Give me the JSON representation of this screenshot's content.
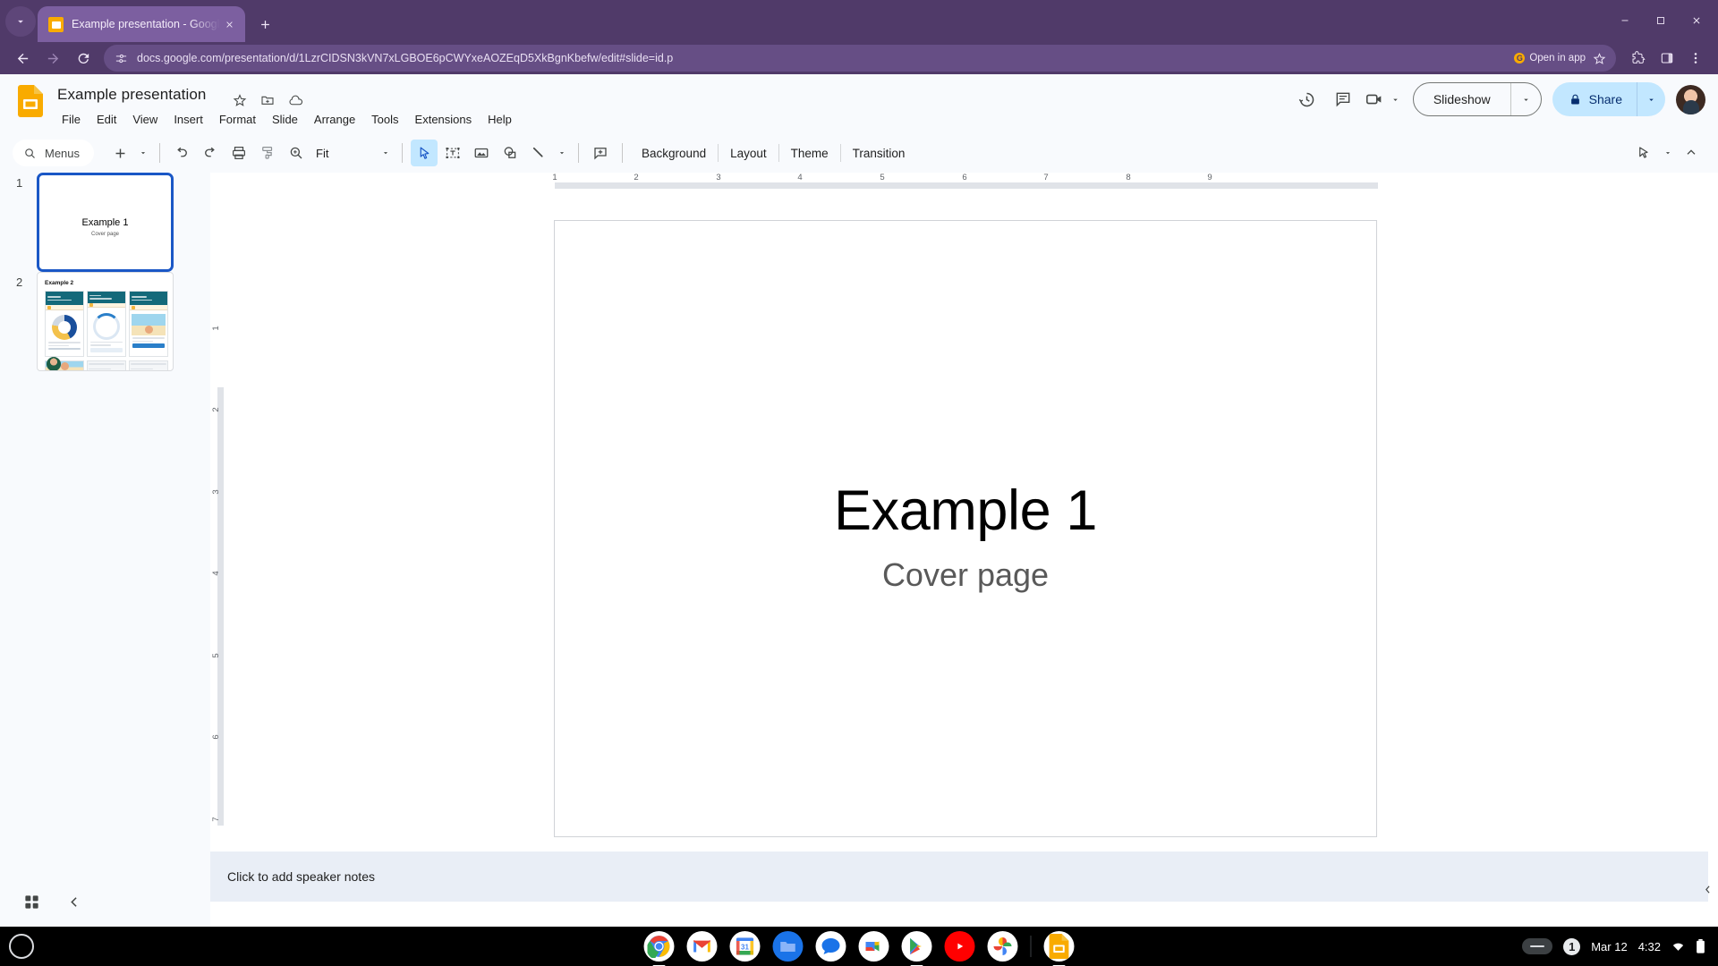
{
  "browser": {
    "tab": {
      "title": "Example presentation - Google Slides",
      "favicon": "slides-favicon"
    },
    "newtab_label": "+",
    "omnibox": {
      "url": "docs.google.com/presentation/d/1LzrCIDSN3kVN7xLGBOE6pCWYxeAOZEqD5XkBgnKbefw/edit#slide=id.p",
      "site_info_icon": "site-settings-icon"
    },
    "open_in_app": {
      "label": "Open in app",
      "badge": "G"
    },
    "window_controls": {
      "minimize": "–",
      "maximize": "□",
      "close": "✕"
    }
  },
  "app": {
    "doc_title": "Example presentation",
    "menus": [
      "File",
      "Edit",
      "View",
      "Insert",
      "Format",
      "Slide",
      "Arrange",
      "Tools",
      "Extensions",
      "Help"
    ],
    "title_icons": [
      "star-icon",
      "move-to-folder-icon",
      "cloud-saved-icon"
    ],
    "header_right": {
      "version_history_icon": "version-history-icon",
      "comment_icon": "comment-icon",
      "meet_icon": "meet-camera-icon",
      "slideshow_label": "Slideshow",
      "share_label": "Share",
      "avatar": "user-avatar"
    }
  },
  "toolbar": {
    "menus_search_label": "Menus",
    "zoom_value": "Fit",
    "icons": [
      "search-icon",
      "new-slide-icon",
      "new-slide-caret-icon",
      "undo-icon",
      "redo-icon",
      "print-icon",
      "paint-format-icon",
      "zoom-icon",
      "select-icon",
      "textbox-icon",
      "image-icon",
      "shape-icon",
      "line-icon",
      "line-caret-icon",
      "comment-add-icon"
    ],
    "text_buttons": [
      "Background",
      "Layout",
      "Theme",
      "Transition"
    ],
    "right_icons": [
      "pen-tool-icon",
      "pen-caret-icon",
      "collapse-toolbar-icon"
    ]
  },
  "filmstrip": {
    "slides": [
      {
        "number": "1",
        "title": "Example 1",
        "subtitle": "Cover page",
        "selected": true
      },
      {
        "number": "2",
        "title": "Example 2",
        "subtitle": "",
        "selected": false
      }
    ],
    "footer_icons": [
      "grid-view-icon",
      "collapse-filmstrip-icon"
    ]
  },
  "canvas": {
    "slide": {
      "title": "Example 1",
      "subtitle": "Cover page"
    },
    "ruler_h_ticks": [
      "1",
      "2",
      "3",
      "4",
      "5",
      "6",
      "7",
      "8",
      "9"
    ],
    "ruler_v_ticks": [
      "1",
      "2",
      "3",
      "4",
      "5",
      "6",
      "7"
    ]
  },
  "notes": {
    "placeholder": "Click to add speaker notes"
  },
  "shelf": {
    "launcher": "launcher-icon",
    "apps": [
      {
        "name": "chrome-app-icon",
        "running": true
      },
      {
        "name": "gmail-app-icon",
        "running": false
      },
      {
        "name": "calendar-app-icon",
        "running": false
      },
      {
        "name": "files-app-icon",
        "running": false
      },
      {
        "name": "messages-app-icon",
        "running": false
      },
      {
        "name": "meet-app-icon",
        "running": false
      },
      {
        "name": "play-store-app-icon",
        "running": true
      },
      {
        "name": "youtube-app-icon",
        "running": false
      },
      {
        "name": "photos-app-icon",
        "running": false
      },
      {
        "name": "slides-app-icon",
        "running": true
      }
    ],
    "status": {
      "date": "Mar 12",
      "time": "4:32",
      "notification_count": "1"
    }
  },
  "colors": {
    "chrome_purple": "#503a69",
    "tab_active": "#7c5fa0",
    "slides_yellow": "#f9ab00",
    "share_blue": "#c2e7ff",
    "selection_blue": "#1a57c6",
    "notes_bg": "#e9eef6"
  }
}
